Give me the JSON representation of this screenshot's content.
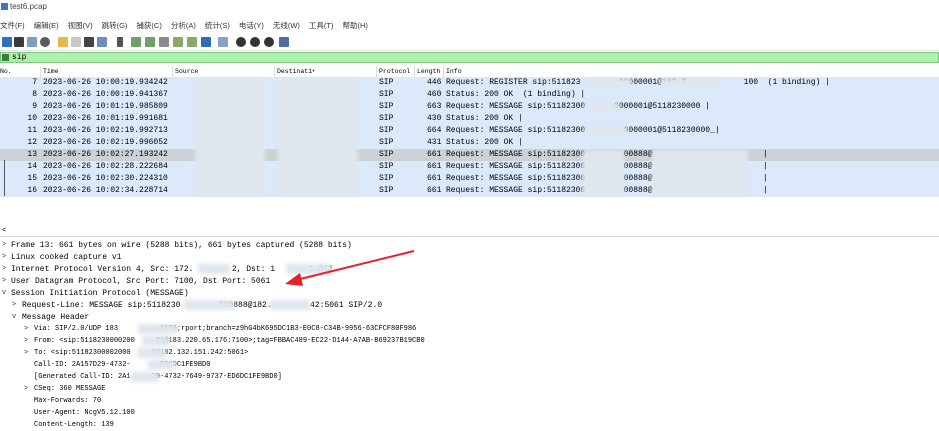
{
  "window": {
    "title": "test6.pcap"
  },
  "menu": [
    "文件(F)",
    "编辑(E)",
    "视图(V)",
    "跳转(G)",
    "捕获(C)",
    "分析(A)",
    "统计(S)",
    "电话(Y)",
    "无线(W)",
    "工具(T)",
    "帮助(H)"
  ],
  "filter": {
    "value": "sip"
  },
  "columns": {
    "no": "No.",
    "time": "Time",
    "source": "Source",
    "destination": "Destinati",
    "protocol": "Protocol",
    "length": "Length",
    "info": "Info"
  },
  "packets": [
    {
      "no": "7",
      "time": "2023-06-26 10:00:19.934242",
      "protocol": "SIP",
      "length": "446",
      "info": "Request: REGISTER sip:511823        00000001@183.2            100  (1 binding) |"
    },
    {
      "no": "8",
      "time": "2023-06-26 10:00:19.941367",
      "protocol": "SIP",
      "length": "460",
      "info": "Status: 200 OK  (1 binding) |"
    },
    {
      "no": "9",
      "time": "2023-06-26 10:01:19.985809",
      "protocol": "SIP",
      "length": "663",
      "info": "Request: MESSAGE sip:51182300      0000001@5118230000 |"
    },
    {
      "no": "10",
      "time": "2023-06-26 10:01:19.991681",
      "protocol": "SIP",
      "length": "430",
      "info": "Status: 200 OK |"
    },
    {
      "no": "11",
      "time": "2023-06-26 10:02:19.992713",
      "protocol": "SIP",
      "length": "664",
      "info": "Request: MESSAGE sip:51182300        0000001@5118230000_|"
    },
    {
      "no": "12",
      "time": "2023-06-26 10:02:19.996052",
      "protocol": "SIP",
      "length": "431",
      "info": "Status: 200 OK |"
    },
    {
      "no": "13",
      "time": "2023-06-26 10:02:27.193242",
      "protocol": "SIP",
      "length": "661",
      "info": "Request: MESSAGE sip:51182300        00888@                       |"
    },
    {
      "no": "14",
      "time": "2023-06-26 10:02:28.222684",
      "protocol": "SIP",
      "length": "661",
      "info": "Request: MESSAGE sip:51182300        00888@                       |"
    },
    {
      "no": "15",
      "time": "2023-06-26 10:02:30.224310",
      "protocol": "SIP",
      "length": "661",
      "info": "Request: MESSAGE sip:51182300        00888@                       |"
    },
    {
      "no": "16",
      "time": "2023-06-26 10:02:34.228714",
      "protocol": "SIP",
      "length": "661",
      "info": "Request: MESSAGE sip:51182300        00888@                       |"
    }
  ],
  "splitter": {
    "label": "<"
  },
  "details": [
    {
      "arrow": ">",
      "text": "Frame 13: 661 bytes on wire (5288 bits), 661 bytes captured (5288 bits)"
    },
    {
      "arrow": ">",
      "text": "Linux cooked capture v1"
    },
    {
      "arrow": ">",
      "text": "Internet Protocol Version 4, Src: 172.        2, Dst: 1       1.242"
    },
    {
      "arrow": ">",
      "text": "User Datagram Protocol, Src Port: 7100, Dst Port: 5061"
    },
    {
      "arrow": "v",
      "text": "Session Initiation Protocol (MESSAGE)"
    },
    {
      "arrow": ">",
      "text": "Request-Line: MESSAGE sip:5118230        000888@182.        42:5061 SIP/2.0"
    },
    {
      "arrow": "v",
      "text": "Message Header"
    },
    {
      "arrow": ">",
      "text": "Via: SIP/2.0/UDP 183         :7100;rport;branch=z9hG4bK695DC1B3-E0C8-C34B-9956-63CFCF80F986"
    },
    {
      "arrow": ">",
      "text": "From: <sip:5118230000200     01@183.220.65.176:7100>;tag=FBBAC489-EC22-D144-A7AB-B69237B19CB0"
    },
    {
      "arrow": ">",
      "text": "To: <sip:51182300002000     8@182.132.151.242:5061>"
    },
    {
      "arrow": "",
      "text": "Call-ID: 2A157D29-4732-      -ED6DC1FE9BD0"
    },
    {
      "arrow": "",
      "text": "[Generated Call-ID: 2A1     29-4732-7649-9737-ED6DC1FE9BD0]"
    },
    {
      "arrow": ">",
      "text": "CSeq: 360 MESSAGE"
    },
    {
      "arrow": "",
      "text": "Max-Forwards: 70"
    },
    {
      "arrow": "",
      "text": "User-Agent: NcgV5.12.100"
    },
    {
      "arrow": "",
      "text": "Content-Length: 139"
    }
  ],
  "colors": {
    "row_bg": "#dbe9fb",
    "selected_row_bg": "#cdd1d6",
    "filter_bg": "#aff0af",
    "annotation_arrow": "#e8202a"
  }
}
